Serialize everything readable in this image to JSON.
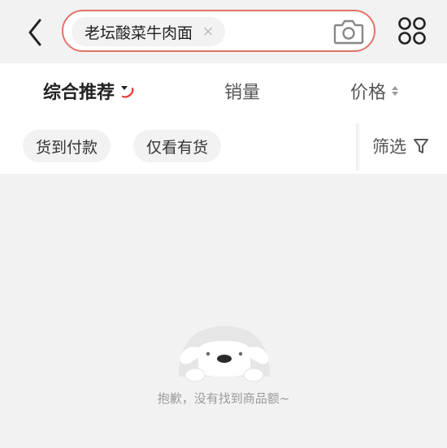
{
  "header": {
    "search_chip_label": "老坛酸菜牛肉面",
    "chip_close_glyph": "×"
  },
  "sort_tabs": [
    {
      "label": "综合推荐",
      "active": true
    },
    {
      "label": "销量",
      "active": false
    },
    {
      "label": "价格",
      "active": false
    }
  ],
  "quick_filters": [
    {
      "label": "货到付款"
    },
    {
      "label": "仅看有货"
    }
  ],
  "filter_button": {
    "label": "筛选"
  },
  "empty_state": {
    "message": "抱歉，没有找到商品额~"
  },
  "colors": {
    "accent": "#e53935",
    "search_border": "#e07468",
    "background": "#f2f2f2"
  },
  "icons": [
    "back-arrow-icon",
    "camera-icon",
    "grid-menu-icon",
    "sort-arrow-icon",
    "funnel-icon",
    "empty-dog-icon"
  ]
}
